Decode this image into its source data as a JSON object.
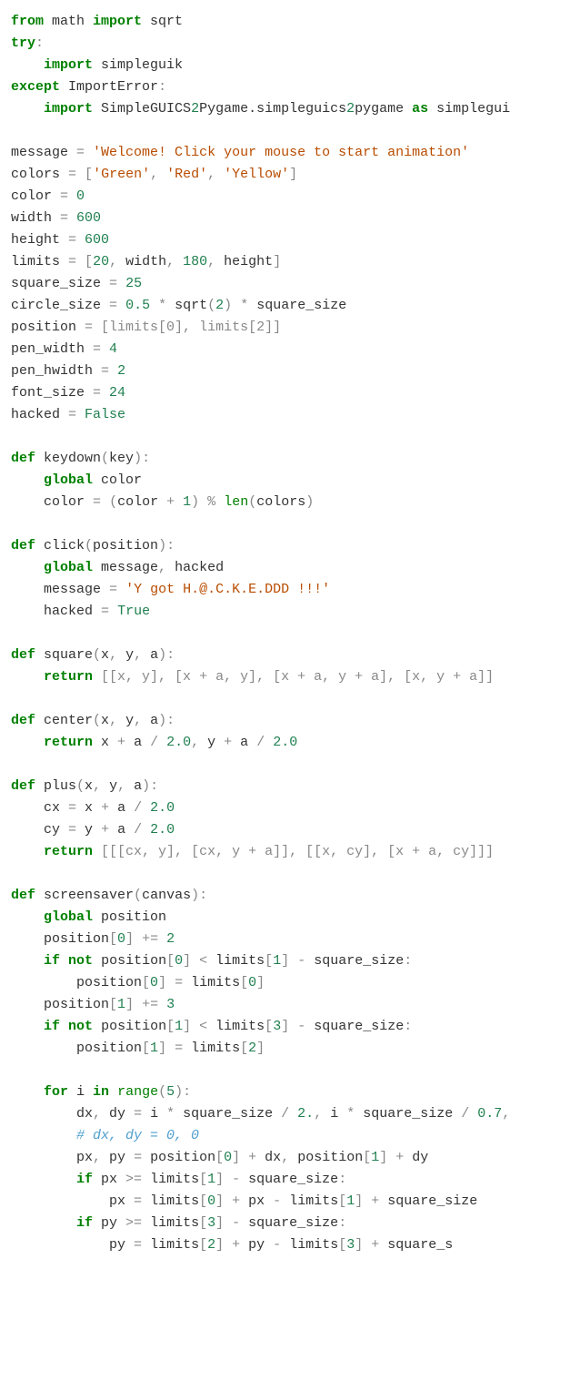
{
  "code_tokens": [
    {
      "c": "kw",
      "t": "from"
    },
    {
      "t": " math "
    },
    {
      "c": "kw",
      "t": "import"
    },
    {
      "t": " sqrt\n"
    },
    {
      "c": "kw",
      "t": "try"
    },
    {
      "c": "op",
      "t": ":"
    },
    {
      "t": "\n"
    },
    {
      "t": "    "
    },
    {
      "c": "kw",
      "t": "import"
    },
    {
      "t": " simpleguik\n"
    },
    {
      "c": "kw",
      "t": "except"
    },
    {
      "t": " "
    },
    {
      "t": "ImportError"
    },
    {
      "c": "op",
      "t": ":"
    },
    {
      "t": "\n"
    },
    {
      "t": "    "
    },
    {
      "c": "kw",
      "t": "import"
    },
    {
      "t": " SimpleGUICS"
    },
    {
      "c": "num",
      "t": "2"
    },
    {
      "t": "Pygame.simpleguics"
    },
    {
      "c": "num",
      "t": "2"
    },
    {
      "t": "pygame "
    },
    {
      "c": "kw",
      "t": "as"
    },
    {
      "t": " simplegui\n"
    },
    {
      "t": "\n"
    },
    {
      "t": "message "
    },
    {
      "c": "op",
      "t": "="
    },
    {
      "t": " "
    },
    {
      "c": "s",
      "t": "'Welcome! Click your mouse to start animation'"
    },
    {
      "t": "\n"
    },
    {
      "t": "colors "
    },
    {
      "c": "op",
      "t": "="
    },
    {
      "t": " "
    },
    {
      "c": "op",
      "t": "["
    },
    {
      "c": "s",
      "t": "'Green'"
    },
    {
      "c": "op",
      "t": ","
    },
    {
      "t": " "
    },
    {
      "c": "s",
      "t": "'Red'"
    },
    {
      "c": "op",
      "t": ","
    },
    {
      "t": " "
    },
    {
      "c": "s",
      "t": "'Yellow'"
    },
    {
      "c": "op",
      "t": "]"
    },
    {
      "t": "\n"
    },
    {
      "t": "color "
    },
    {
      "c": "op",
      "t": "="
    },
    {
      "t": " "
    },
    {
      "c": "num",
      "t": "0"
    },
    {
      "t": "\n"
    },
    {
      "t": "width "
    },
    {
      "c": "op",
      "t": "="
    },
    {
      "t": " "
    },
    {
      "c": "num",
      "t": "600"
    },
    {
      "t": "\n"
    },
    {
      "t": "height "
    },
    {
      "c": "op",
      "t": "="
    },
    {
      "t": " "
    },
    {
      "c": "num",
      "t": "600"
    },
    {
      "t": "\n"
    },
    {
      "t": "limits "
    },
    {
      "c": "op",
      "t": "="
    },
    {
      "t": " "
    },
    {
      "c": "op",
      "t": "["
    },
    {
      "c": "num",
      "t": "20"
    },
    {
      "c": "op",
      "t": ","
    },
    {
      "t": " width"
    },
    {
      "c": "op",
      "t": ","
    },
    {
      "t": " "
    },
    {
      "c": "num",
      "t": "180"
    },
    {
      "c": "op",
      "t": ","
    },
    {
      "t": " height"
    },
    {
      "c": "op",
      "t": "]"
    },
    {
      "t": "\n"
    },
    {
      "t": "square_size "
    },
    {
      "c": "op",
      "t": "="
    },
    {
      "t": " "
    },
    {
      "c": "num",
      "t": "25"
    },
    {
      "t": "\n"
    },
    {
      "t": "circle_size "
    },
    {
      "c": "op",
      "t": "="
    },
    {
      "t": " "
    },
    {
      "c": "num",
      "t": "0.5"
    },
    {
      "t": " "
    },
    {
      "c": "op",
      "t": "*"
    },
    {
      "t": " sqrt"
    },
    {
      "c": "op",
      "t": "("
    },
    {
      "c": "num",
      "t": "2"
    },
    {
      "c": "op",
      "t": ")"
    },
    {
      "t": " "
    },
    {
      "c": "op",
      "t": "*"
    },
    {
      "t": " square_size\n"
    },
    {
      "t": "position "
    },
    {
      "c": "op",
      "t": "="
    },
    {
      "t": " "
    },
    {
      "c": "op",
      "t": "[limits[0], limits[2]]"
    },
    {
      "t": "\n"
    },
    {
      "t": "pen_width "
    },
    {
      "c": "op",
      "t": "="
    },
    {
      "t": " "
    },
    {
      "c": "num",
      "t": "4"
    },
    {
      "t": "\n"
    },
    {
      "t": "pen_hwidth "
    },
    {
      "c": "op",
      "t": "="
    },
    {
      "t": " "
    },
    {
      "c": "num",
      "t": "2"
    },
    {
      "t": "\n"
    },
    {
      "t": "font_size "
    },
    {
      "c": "op",
      "t": "="
    },
    {
      "t": " "
    },
    {
      "c": "num",
      "t": "24"
    },
    {
      "t": "\n"
    },
    {
      "t": "hacked "
    },
    {
      "c": "op",
      "t": "="
    },
    {
      "t": " "
    },
    {
      "c": "num",
      "t": "False"
    },
    {
      "t": "\n"
    },
    {
      "t": "\n"
    },
    {
      "c": "kw",
      "t": "def"
    },
    {
      "t": " keydown"
    },
    {
      "c": "op",
      "t": "("
    },
    {
      "t": "key"
    },
    {
      "c": "op",
      "t": "):"
    },
    {
      "t": "\n"
    },
    {
      "t": "    "
    },
    {
      "c": "kw",
      "t": "global"
    },
    {
      "t": " color\n"
    },
    {
      "t": "    color "
    },
    {
      "c": "op",
      "t": "="
    },
    {
      "t": " "
    },
    {
      "c": "op",
      "t": "("
    },
    {
      "t": "color "
    },
    {
      "c": "op",
      "t": "+"
    },
    {
      "t": " "
    },
    {
      "c": "num",
      "t": "1"
    },
    {
      "c": "op",
      "t": ")"
    },
    {
      "t": " "
    },
    {
      "c": "op",
      "t": "%"
    },
    {
      "t": " "
    },
    {
      "c": "bi",
      "t": "len"
    },
    {
      "c": "op",
      "t": "("
    },
    {
      "t": "colors"
    },
    {
      "c": "op",
      "t": ")"
    },
    {
      "t": "\n"
    },
    {
      "t": "\n"
    },
    {
      "c": "kw",
      "t": "def"
    },
    {
      "t": " click"
    },
    {
      "c": "op",
      "t": "("
    },
    {
      "t": "position"
    },
    {
      "c": "op",
      "t": "):"
    },
    {
      "t": "\n"
    },
    {
      "t": "    "
    },
    {
      "c": "kw",
      "t": "global"
    },
    {
      "t": " message"
    },
    {
      "c": "op",
      "t": ","
    },
    {
      "t": " hacked\n"
    },
    {
      "t": "    message "
    },
    {
      "c": "op",
      "t": "="
    },
    {
      "t": " "
    },
    {
      "c": "s",
      "t": "'Y got H.@.C.K.E.DDD !!!'"
    },
    {
      "t": "\n"
    },
    {
      "t": "    hacked "
    },
    {
      "c": "op",
      "t": "="
    },
    {
      "t": " "
    },
    {
      "c": "num",
      "t": "True"
    },
    {
      "t": "\n"
    },
    {
      "t": "\n"
    },
    {
      "c": "kw",
      "t": "def"
    },
    {
      "t": " square"
    },
    {
      "c": "op",
      "t": "("
    },
    {
      "t": "x"
    },
    {
      "c": "op",
      "t": ","
    },
    {
      "t": " y"
    },
    {
      "c": "op",
      "t": ","
    },
    {
      "t": " a"
    },
    {
      "c": "op",
      "t": "):"
    },
    {
      "t": "\n"
    },
    {
      "t": "    "
    },
    {
      "c": "kw",
      "t": "return"
    },
    {
      "t": " "
    },
    {
      "c": "op",
      "t": "[[x, y], [x + a, y], [x + a, y + a], [x, y + a]]"
    },
    {
      "t": "\n"
    },
    {
      "t": "\n"
    },
    {
      "c": "kw",
      "t": "def"
    },
    {
      "t": " center"
    },
    {
      "c": "op",
      "t": "("
    },
    {
      "t": "x"
    },
    {
      "c": "op",
      "t": ","
    },
    {
      "t": " y"
    },
    {
      "c": "op",
      "t": ","
    },
    {
      "t": " a"
    },
    {
      "c": "op",
      "t": "):"
    },
    {
      "t": "\n"
    },
    {
      "t": "    "
    },
    {
      "c": "kw",
      "t": "return"
    },
    {
      "t": " x "
    },
    {
      "c": "op",
      "t": "+"
    },
    {
      "t": " a "
    },
    {
      "c": "op",
      "t": "/"
    },
    {
      "t": " "
    },
    {
      "c": "num",
      "t": "2.0"
    },
    {
      "c": "op",
      "t": ","
    },
    {
      "t": " y "
    },
    {
      "c": "op",
      "t": "+"
    },
    {
      "t": " a "
    },
    {
      "c": "op",
      "t": "/"
    },
    {
      "t": " "
    },
    {
      "c": "num",
      "t": "2.0"
    },
    {
      "t": "\n"
    },
    {
      "t": "\n"
    },
    {
      "c": "kw",
      "t": "def"
    },
    {
      "t": " plus"
    },
    {
      "c": "op",
      "t": "("
    },
    {
      "t": "x"
    },
    {
      "c": "op",
      "t": ","
    },
    {
      "t": " y"
    },
    {
      "c": "op",
      "t": ","
    },
    {
      "t": " a"
    },
    {
      "c": "op",
      "t": "):"
    },
    {
      "t": "\n"
    },
    {
      "t": "    cx "
    },
    {
      "c": "op",
      "t": "="
    },
    {
      "t": " x "
    },
    {
      "c": "op",
      "t": "+"
    },
    {
      "t": " a "
    },
    {
      "c": "op",
      "t": "/"
    },
    {
      "t": " "
    },
    {
      "c": "num",
      "t": "2.0"
    },
    {
      "t": "\n"
    },
    {
      "t": "    cy "
    },
    {
      "c": "op",
      "t": "="
    },
    {
      "t": " y "
    },
    {
      "c": "op",
      "t": "+"
    },
    {
      "t": " a "
    },
    {
      "c": "op",
      "t": "/"
    },
    {
      "t": " "
    },
    {
      "c": "num",
      "t": "2.0"
    },
    {
      "t": "\n"
    },
    {
      "t": "    "
    },
    {
      "c": "kw",
      "t": "return"
    },
    {
      "t": " "
    },
    {
      "c": "op",
      "t": "[[[cx, y], [cx, y + a]], [[x, cy], [x + a, cy]]]"
    },
    {
      "t": "\n"
    },
    {
      "t": "\n"
    },
    {
      "c": "kw",
      "t": "def"
    },
    {
      "t": " screensaver"
    },
    {
      "c": "op",
      "t": "("
    },
    {
      "t": "canvas"
    },
    {
      "c": "op",
      "t": "):"
    },
    {
      "t": "\n"
    },
    {
      "t": "    "
    },
    {
      "c": "kw",
      "t": "global"
    },
    {
      "t": " position\n"
    },
    {
      "t": "    position"
    },
    {
      "c": "op",
      "t": "["
    },
    {
      "c": "num",
      "t": "0"
    },
    {
      "c": "op",
      "t": "]"
    },
    {
      "t": " "
    },
    {
      "c": "op",
      "t": "+="
    },
    {
      "t": " "
    },
    {
      "c": "num",
      "t": "2"
    },
    {
      "t": "\n"
    },
    {
      "t": "    "
    },
    {
      "c": "kw",
      "t": "if"
    },
    {
      "t": " "
    },
    {
      "c": "kw",
      "t": "not"
    },
    {
      "t": " position"
    },
    {
      "c": "op",
      "t": "["
    },
    {
      "c": "num",
      "t": "0"
    },
    {
      "c": "op",
      "t": "]"
    },
    {
      "t": " "
    },
    {
      "c": "op",
      "t": "<"
    },
    {
      "t": " limits"
    },
    {
      "c": "op",
      "t": "["
    },
    {
      "c": "num",
      "t": "1"
    },
    {
      "c": "op",
      "t": "]"
    },
    {
      "t": " "
    },
    {
      "c": "op",
      "t": "-"
    },
    {
      "t": " square_size"
    },
    {
      "c": "op",
      "t": ":"
    },
    {
      "t": "\n"
    },
    {
      "t": "        position"
    },
    {
      "c": "op",
      "t": "["
    },
    {
      "c": "num",
      "t": "0"
    },
    {
      "c": "op",
      "t": "]"
    },
    {
      "t": " "
    },
    {
      "c": "op",
      "t": "="
    },
    {
      "t": " limits"
    },
    {
      "c": "op",
      "t": "["
    },
    {
      "c": "num",
      "t": "0"
    },
    {
      "c": "op",
      "t": "]"
    },
    {
      "t": "\n"
    },
    {
      "t": "    position"
    },
    {
      "c": "op",
      "t": "["
    },
    {
      "c": "num",
      "t": "1"
    },
    {
      "c": "op",
      "t": "]"
    },
    {
      "t": " "
    },
    {
      "c": "op",
      "t": "+="
    },
    {
      "t": " "
    },
    {
      "c": "num",
      "t": "3"
    },
    {
      "t": "\n"
    },
    {
      "t": "    "
    },
    {
      "c": "kw",
      "t": "if"
    },
    {
      "t": " "
    },
    {
      "c": "kw",
      "t": "not"
    },
    {
      "t": " position"
    },
    {
      "c": "op",
      "t": "["
    },
    {
      "c": "num",
      "t": "1"
    },
    {
      "c": "op",
      "t": "]"
    },
    {
      "t": " "
    },
    {
      "c": "op",
      "t": "<"
    },
    {
      "t": " limits"
    },
    {
      "c": "op",
      "t": "["
    },
    {
      "c": "num",
      "t": "3"
    },
    {
      "c": "op",
      "t": "]"
    },
    {
      "t": " "
    },
    {
      "c": "op",
      "t": "-"
    },
    {
      "t": " square_size"
    },
    {
      "c": "op",
      "t": ":"
    },
    {
      "t": "\n"
    },
    {
      "t": "        position"
    },
    {
      "c": "op",
      "t": "["
    },
    {
      "c": "num",
      "t": "1"
    },
    {
      "c": "op",
      "t": "]"
    },
    {
      "t": " "
    },
    {
      "c": "op",
      "t": "="
    },
    {
      "t": " limits"
    },
    {
      "c": "op",
      "t": "["
    },
    {
      "c": "num",
      "t": "2"
    },
    {
      "c": "op",
      "t": "]"
    },
    {
      "t": "\n"
    },
    {
      "t": "\n"
    },
    {
      "t": "    "
    },
    {
      "c": "kw",
      "t": "for"
    },
    {
      "t": " i "
    },
    {
      "c": "kw",
      "t": "in"
    },
    {
      "t": " "
    },
    {
      "c": "bi",
      "t": "range"
    },
    {
      "c": "op",
      "t": "("
    },
    {
      "c": "num",
      "t": "5"
    },
    {
      "c": "op",
      "t": "):"
    },
    {
      "t": "\n"
    },
    {
      "t": "        dx"
    },
    {
      "c": "op",
      "t": ","
    },
    {
      "t": " dy "
    },
    {
      "c": "op",
      "t": "="
    },
    {
      "t": " i "
    },
    {
      "c": "op",
      "t": "*"
    },
    {
      "t": " square_size "
    },
    {
      "c": "op",
      "t": "/"
    },
    {
      "t": " "
    },
    {
      "c": "num",
      "t": "2."
    },
    {
      "c": "op",
      "t": ","
    },
    {
      "t": " i "
    },
    {
      "c": "op",
      "t": "*"
    },
    {
      "t": " square_size "
    },
    {
      "c": "op",
      "t": "/"
    },
    {
      "t": " "
    },
    {
      "c": "num",
      "t": "0.7"
    },
    {
      "c": "op",
      "t": ","
    },
    {
      "t": "\n"
    },
    {
      "t": "        "
    },
    {
      "c": "cm",
      "t": "# dx, dy = 0, 0"
    },
    {
      "t": "\n"
    },
    {
      "t": "        px"
    },
    {
      "c": "op",
      "t": ","
    },
    {
      "t": " py "
    },
    {
      "c": "op",
      "t": "="
    },
    {
      "t": " position"
    },
    {
      "c": "op",
      "t": "["
    },
    {
      "c": "num",
      "t": "0"
    },
    {
      "c": "op",
      "t": "]"
    },
    {
      "t": " "
    },
    {
      "c": "op",
      "t": "+"
    },
    {
      "t": " dx"
    },
    {
      "c": "op",
      "t": ","
    },
    {
      "t": " position"
    },
    {
      "c": "op",
      "t": "["
    },
    {
      "c": "num",
      "t": "1"
    },
    {
      "c": "op",
      "t": "]"
    },
    {
      "t": " "
    },
    {
      "c": "op",
      "t": "+"
    },
    {
      "t": " dy\n"
    },
    {
      "t": "        "
    },
    {
      "c": "kw",
      "t": "if"
    },
    {
      "t": " px "
    },
    {
      "c": "op",
      "t": ">="
    },
    {
      "t": " limits"
    },
    {
      "c": "op",
      "t": "["
    },
    {
      "c": "num",
      "t": "1"
    },
    {
      "c": "op",
      "t": "]"
    },
    {
      "t": " "
    },
    {
      "c": "op",
      "t": "-"
    },
    {
      "t": " square_size"
    },
    {
      "c": "op",
      "t": ":"
    },
    {
      "t": "\n"
    },
    {
      "t": "            px "
    },
    {
      "c": "op",
      "t": "="
    },
    {
      "t": " limits"
    },
    {
      "c": "op",
      "t": "["
    },
    {
      "c": "num",
      "t": "0"
    },
    {
      "c": "op",
      "t": "]"
    },
    {
      "t": " "
    },
    {
      "c": "op",
      "t": "+"
    },
    {
      "t": " px "
    },
    {
      "c": "op",
      "t": "-"
    },
    {
      "t": " limits"
    },
    {
      "c": "op",
      "t": "["
    },
    {
      "c": "num",
      "t": "1"
    },
    {
      "c": "op",
      "t": "]"
    },
    {
      "t": " "
    },
    {
      "c": "op",
      "t": "+"
    },
    {
      "t": " square_size\n"
    },
    {
      "t": "        "
    },
    {
      "c": "kw",
      "t": "if"
    },
    {
      "t": " py "
    },
    {
      "c": "op",
      "t": ">="
    },
    {
      "t": " limits"
    },
    {
      "c": "op",
      "t": "["
    },
    {
      "c": "num",
      "t": "3"
    },
    {
      "c": "op",
      "t": "]"
    },
    {
      "t": " "
    },
    {
      "c": "op",
      "t": "-"
    },
    {
      "t": " square_size"
    },
    {
      "c": "op",
      "t": ":"
    },
    {
      "t": "\n"
    },
    {
      "t": "            py "
    },
    {
      "c": "op",
      "t": "="
    },
    {
      "t": " limits"
    },
    {
      "c": "op",
      "t": "["
    },
    {
      "c": "num",
      "t": "2"
    },
    {
      "c": "op",
      "t": "]"
    },
    {
      "t": " "
    },
    {
      "c": "op",
      "t": "+"
    },
    {
      "t": " py "
    },
    {
      "c": "op",
      "t": "-"
    },
    {
      "t": " limits"
    },
    {
      "c": "op",
      "t": "["
    },
    {
      "c": "num",
      "t": "3"
    },
    {
      "c": "op",
      "t": "]"
    },
    {
      "t": " "
    },
    {
      "c": "op",
      "t": "+"
    },
    {
      "t": " square_s"
    }
  ]
}
